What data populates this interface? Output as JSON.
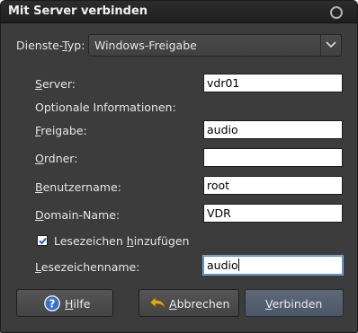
{
  "window": {
    "title": "Mit Server verbinden"
  },
  "service_type": {
    "label_pre": "Dienste-",
    "label_ul": "T",
    "label_post": "yp:",
    "value": "Windows-Freigabe"
  },
  "server": {
    "label_ul": "S",
    "label_post": "erver:",
    "value": "vdr01"
  },
  "optional_heading": "Optionale Informationen:",
  "share": {
    "label_ul": "F",
    "label_post": "reigabe:",
    "value": "audio"
  },
  "folder": {
    "label_ul": "O",
    "label_post": "rdner:",
    "value": ""
  },
  "username": {
    "label_ul": "B",
    "label_post": "enutzername:",
    "value": "root"
  },
  "domain": {
    "label_ul": "D",
    "label_post": "omain-Name:",
    "value": "VDR"
  },
  "bookmark_checkbox": {
    "label_pre": "Lesezeichen ",
    "label_ul": "h",
    "label_post": "inzufügen",
    "checked": true
  },
  "bookmark_name": {
    "label_ul": "L",
    "label_post": "esezeichenname:",
    "value": "audio"
  },
  "buttons": {
    "help": {
      "label_ul": "H",
      "label_post": "ilfe",
      "icon": "help-icon"
    },
    "cancel": {
      "label_ul": "A",
      "label_post": "bbrechen",
      "icon": "undo-arrow-icon"
    },
    "connect": {
      "label_ul": "V",
      "label_post": "erbinden"
    }
  },
  "colors": {
    "window_bg": "#3c3c3c",
    "text": "#e6e6e6",
    "help_icon": "#3a6fc4",
    "cancel_icon": "#e0a81e",
    "focus": "#7aa6d6"
  }
}
